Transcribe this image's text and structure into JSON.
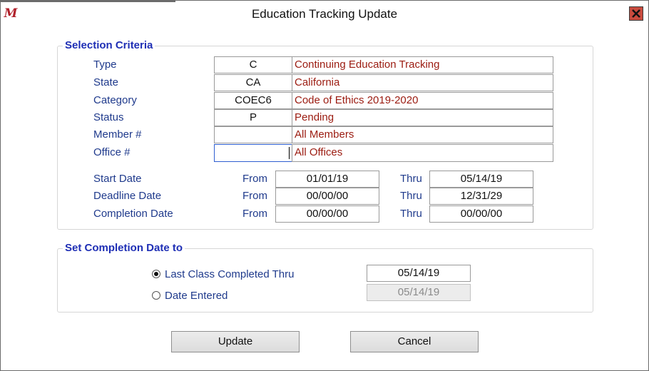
{
  "window": {
    "title": "Education Tracking Update",
    "app_icon_glyph": "M",
    "close_icon": "close-icon",
    "accent_close_color": "#c94b3e"
  },
  "selection": {
    "legend": "Selection Criteria",
    "fields": [
      {
        "label": "Type",
        "code": "C",
        "desc": "Continuing Education Tracking"
      },
      {
        "label": "State",
        "code": "CA",
        "desc": "California"
      },
      {
        "label": "Category",
        "code": "COEC6",
        "desc": "Code of Ethics 2019-2020"
      },
      {
        "label": "Status",
        "code": "P",
        "desc": "Pending"
      },
      {
        "label": "Member #",
        "code": "",
        "desc": "All Members"
      },
      {
        "label": "Office #",
        "code": "",
        "desc": "All Offices"
      }
    ],
    "dates": [
      {
        "label": "Start Date",
        "from_label": "From",
        "from": "01/01/19",
        "thru_label": "Thru",
        "thru": "05/14/19"
      },
      {
        "label": "Deadline Date",
        "from_label": "From",
        "from": "00/00/00",
        "thru_label": "Thru",
        "thru": "12/31/29"
      },
      {
        "label": "Completion Date",
        "from_label": "From",
        "from": "00/00/00",
        "thru_label": "Thru",
        "thru": "00/00/00"
      }
    ]
  },
  "completion": {
    "legend": "Set Completion Date to",
    "options": [
      {
        "label": "Last Class Completed Thru",
        "value": "05/14/19",
        "selected": true,
        "enabled": true
      },
      {
        "label": "Date Entered",
        "value": "05/14/19",
        "selected": false,
        "enabled": false
      }
    ]
  },
  "buttons": {
    "update": "Update",
    "cancel": "Cancel"
  }
}
